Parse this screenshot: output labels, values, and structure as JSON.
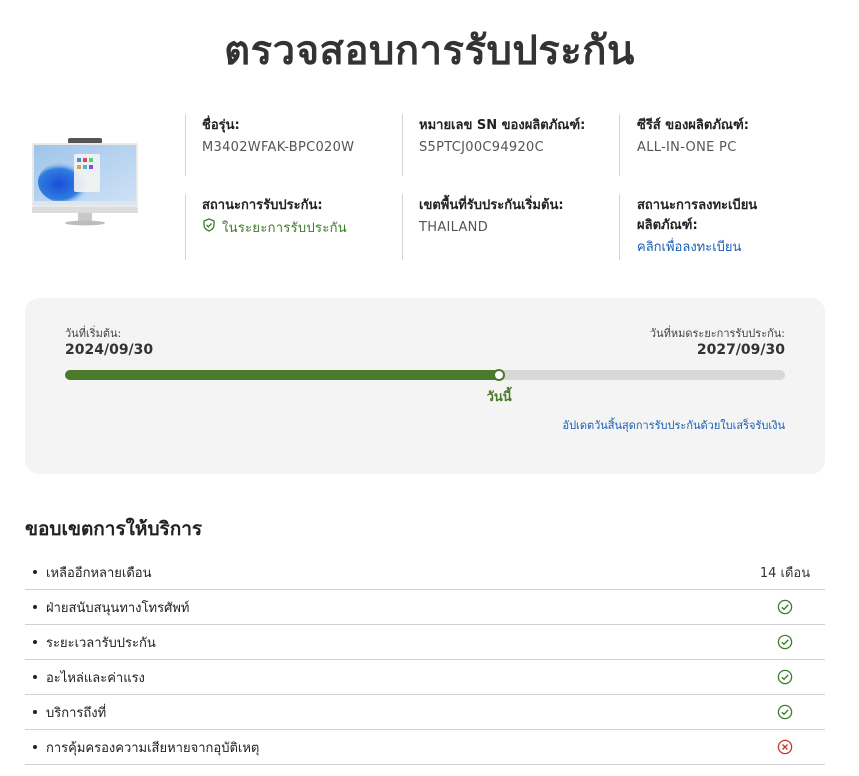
{
  "page_title": "ตรวจสอบการรับประกัน",
  "product": {
    "image_icon": "all-in-one-pc-image",
    "model_label": "ชื่อรุ่น:",
    "model_value": "M3402WFAK-BPC020W",
    "serial_label": "หมายเลข SN ของผลิตภัณฑ์:",
    "serial_value": "S5PTCJ00C94920C",
    "series_label": "ซีรีส์ ของผลิตภัณฑ์:",
    "series_value": "ALL-IN-ONE PC",
    "status_label": "สถานะการรับประกัน:",
    "status_value": "ในระยะการรับประกัน",
    "status_icon": "shield-check-icon",
    "region_label": "เขตพื้นที่รับประกันเริ่มต้น:",
    "region_value": "THAILAND",
    "registration_label": "สถานะการลงทะเบียนผลิตภัณฑ์:",
    "registration_link": "คลิกเพื่อลงทะเบียน"
  },
  "period": {
    "start_label": "วันที่เริ่มต้น:",
    "start_date": "2024/09/30",
    "end_label": "วันที่หมดระยะการรับประกัน:",
    "end_date": "2027/09/30",
    "today_label": "วันนี้",
    "progress_fraction": 0.603,
    "update_link": "อัปเดตวันสิ้นสุดการรับประกันด้วยใบเสร็จรับเงิน"
  },
  "service_scope": {
    "title": "ขอบเขตการให้บริการ",
    "items": [
      {
        "name": "เหลืออีกหลายเดือน",
        "value": "14 เดือน",
        "status": "text"
      },
      {
        "name": "ฝ่ายสนับสนุนทางโทรศัพท์",
        "value": "",
        "status": "check"
      },
      {
        "name": "ระยะเวลารับประกัน",
        "value": "",
        "status": "check"
      },
      {
        "name": "อะไหล่และค่าแรง",
        "value": "",
        "status": "check"
      },
      {
        "name": "บริการถึงที่",
        "value": "",
        "status": "check"
      },
      {
        "name": "การคุ้มครองความเสียหายจากอุบัติเหตุ",
        "value": "",
        "status": "cross"
      }
    ]
  },
  "colors": {
    "ok_green": "#3a7d2a",
    "progress_green": "#4a7a2a",
    "link_blue": "#1a5fb4",
    "cross_red": "#c0392b"
  }
}
